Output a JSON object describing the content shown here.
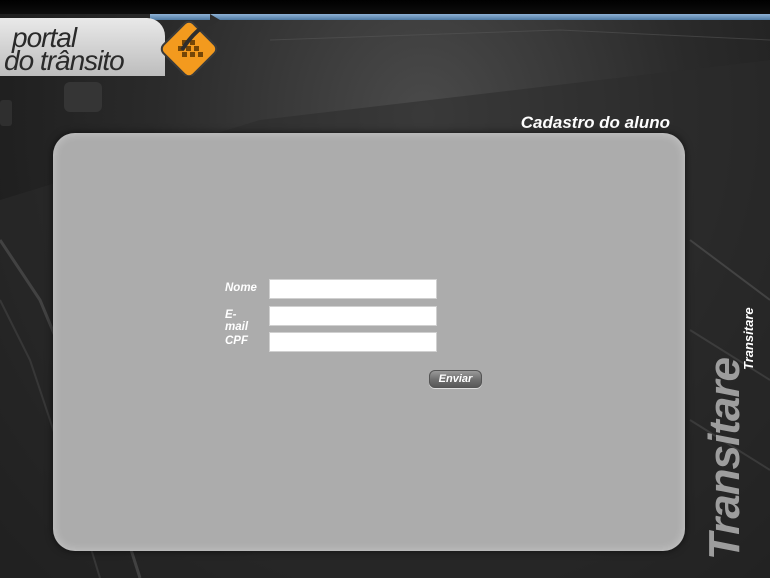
{
  "logo": {
    "line1": "portal",
    "line2": "do trânsito"
  },
  "page": {
    "title": "Cadastro do aluno"
  },
  "form": {
    "fields": [
      {
        "label": "Nome",
        "value": ""
      },
      {
        "label": "E-mail",
        "value": ""
      },
      {
        "label": "CPF",
        "value": ""
      }
    ],
    "submit_label": "Enviar"
  },
  "brand": {
    "large": "Transitare",
    "small": "Transitare"
  },
  "colors": {
    "accent_orange": "#f39a1e",
    "top_line_blue": "#7aa3cc",
    "card_gray": "#acacac"
  }
}
